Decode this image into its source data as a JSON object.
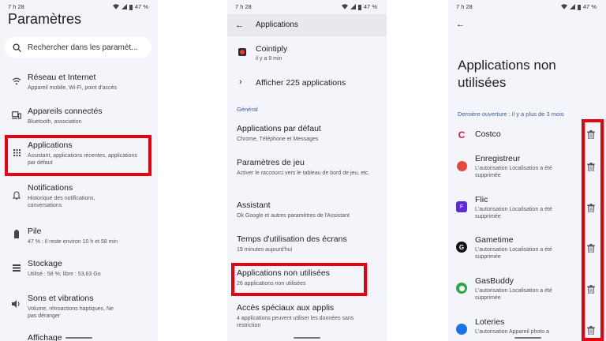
{
  "status": {
    "time": "7 h 28",
    "battery": "47 %"
  },
  "settings": {
    "title": "Paramètres",
    "search_placeholder": "Rechercher dans les paramèt...",
    "items": [
      {
        "title": "Réseau et Internet",
        "subtitle": "Appareil mobile, Wi-Fi, point d'accès",
        "icon": "wifi-icon"
      },
      {
        "title": "Appareils connectés",
        "subtitle": "Bluetooth, association",
        "icon": "devices-icon"
      },
      {
        "title": "Applications",
        "subtitle": "Assistant, applications récentes, applications par défaut",
        "icon": "apps-grid-icon"
      },
      {
        "title": "Notifications",
        "subtitle": "Historique des notifications, conversations",
        "icon": "bell-icon"
      },
      {
        "title": "Pile",
        "subtitle": "47 % : Il reste environ 10 h et 58 min",
        "icon": "battery-icon"
      },
      {
        "title": "Stockage",
        "subtitle": "Utilisé : 58 %; libre : 53,63 Go",
        "icon": "storage-icon"
      },
      {
        "title": "Sons et vibrations",
        "subtitle": "Volume, rétroactions haptiques, Ne pas déranger",
        "icon": "volume-icon"
      },
      {
        "title": "Affichage",
        "subtitle": "",
        "icon": "display-icon"
      }
    ]
  },
  "applications": {
    "title": "Applications",
    "recent_app": {
      "name": "Cointiply",
      "time": "il y a 9 min"
    },
    "show_all": "Afficher 225 applications",
    "section": "Général",
    "items": [
      {
        "title": "Applications par défaut",
        "subtitle": "Chrome, Téléphone et Messages"
      },
      {
        "title": "Paramètres de jeu",
        "subtitle": "Activer le raccourci vers le tableau de bord de jeu, etc."
      },
      {
        "title": "Assistant",
        "subtitle": "Ok Google et autres paramètres de l'Assistant"
      },
      {
        "title": "Temps d'utilisation des écrans",
        "subtitle": "19 minutes aujourd'hui"
      },
      {
        "title": "Applications non utilisées",
        "subtitle": "26 applications non utilisées"
      },
      {
        "title": "Accès spéciaux aux applis",
        "subtitle": "4 applications peuvent utiliser les données sans restriction"
      }
    ]
  },
  "unused": {
    "title_line1": "Applications non",
    "title_line2": "utilisées",
    "section": "Dernière ouverture : il y a plus de 3 mois",
    "apps": [
      {
        "name": "Costco",
        "subtitle": "",
        "color": "#e31837"
      },
      {
        "name": "Enregistreur",
        "subtitle": "L'autorisation Localisation a été supprimée",
        "color": "#e8453c"
      },
      {
        "name": "Flic",
        "subtitle": "L'autorisation Localisation a été supprimée",
        "color": "#5b2bd6"
      },
      {
        "name": "Gametime",
        "subtitle": "L'autorisation Localisation a été supprimée",
        "color": "#111111"
      },
      {
        "name": "GasBuddy",
        "subtitle": "L'autorisation Localisation a été supprimée",
        "color": "#2aa84a"
      },
      {
        "name": "Loteries",
        "subtitle": "L'autorisation Appareil photo a",
        "color": "#1a73e8"
      }
    ]
  }
}
